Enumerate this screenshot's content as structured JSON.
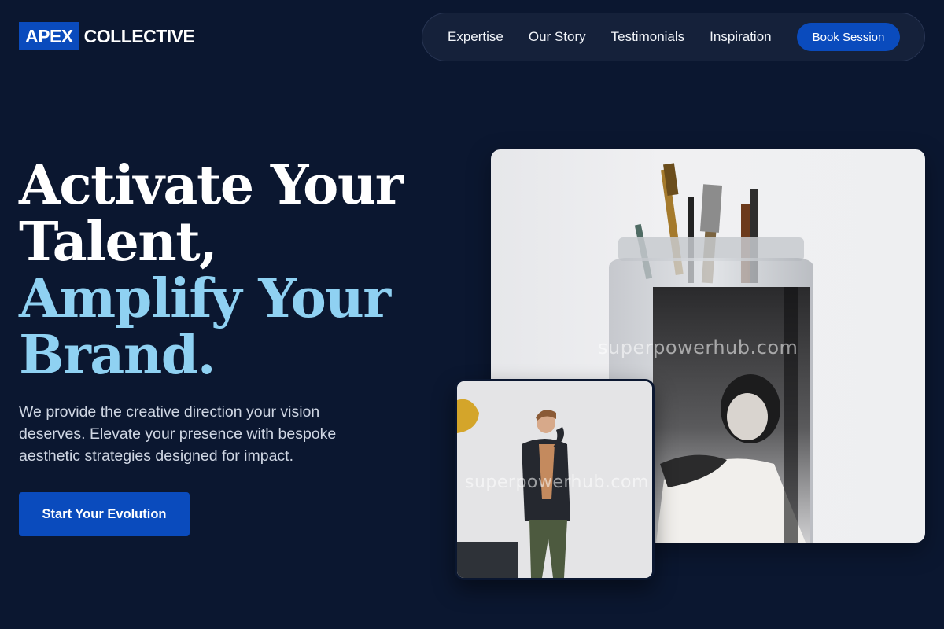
{
  "brand": {
    "logo_box": "APEX",
    "logo_text": "COLLECTIVE"
  },
  "nav": {
    "links": [
      "Expertise",
      "Our Story",
      "Testimonials",
      "Inspiration"
    ],
    "cta": "Book Session"
  },
  "hero": {
    "headline_line1": "Activate Your",
    "headline_line2": "Talent,",
    "headline_line3": "Amplify Your",
    "headline_line4": "Brand.",
    "lede": "We provide the creative direction your vision deserves. Elevate your presence with bespoke aesthetic strategies designed for impact.",
    "cta": "Start Your Evolution"
  },
  "images": {
    "main_watermark": "superpowerhub.com",
    "small_watermark": "superpowerhub.com"
  },
  "colors": {
    "background": "#0b1730",
    "accent": "#0a4bbd",
    "highlight": "#8fd1f2"
  }
}
